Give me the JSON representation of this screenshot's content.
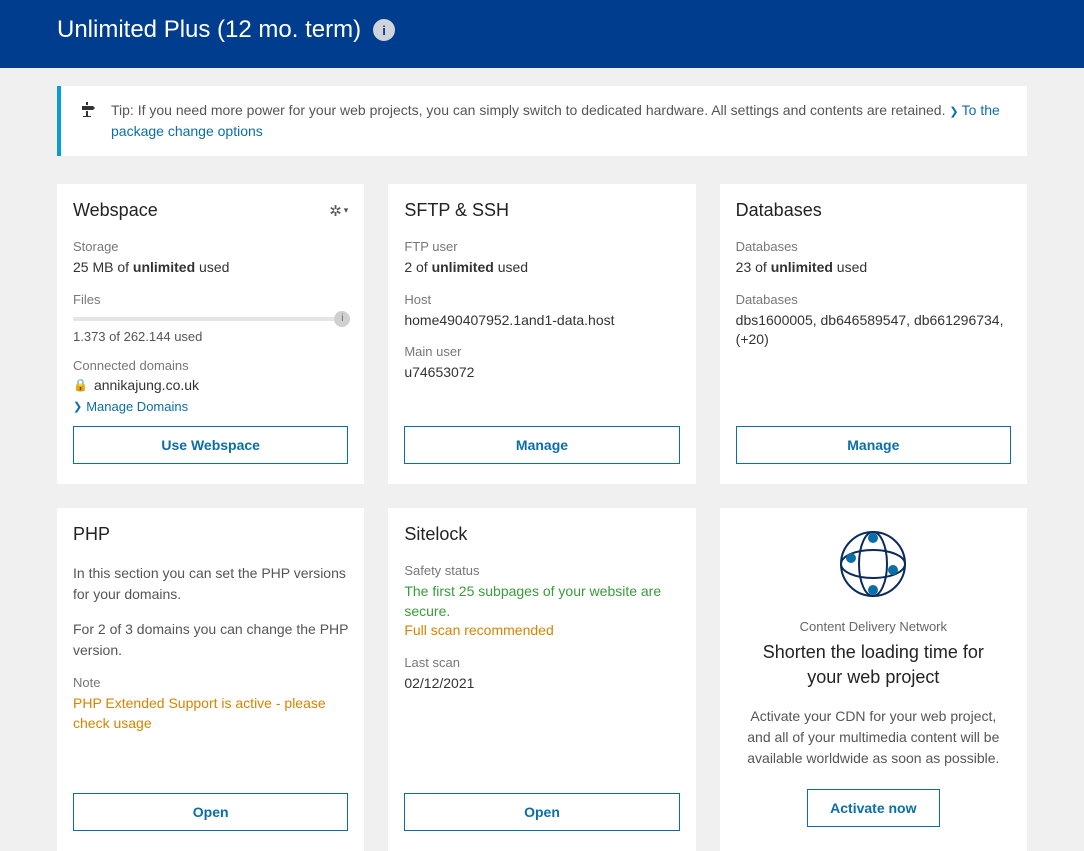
{
  "header": {
    "title": "Unlimited Plus (12 mo. term)"
  },
  "tip": {
    "text": "Tip: If you need more power for your web projects, you can simply switch to dedicated hardware. All settings and contents are retained.",
    "link": "To the package change options"
  },
  "webspace": {
    "title": "Webspace",
    "storage_label": "Storage",
    "storage_prefix": "25 MB of ",
    "storage_bold": "unlimited",
    "storage_suffix": " used",
    "files_label": "Files",
    "files_value": "1.373 of 262.144 used",
    "domains_label": "Connected domains",
    "domain": "annikajung.co.uk",
    "manage_domains": "Manage Domains",
    "button": "Use Webspace"
  },
  "sftp": {
    "title": "SFTP & SSH",
    "ftp_label": "FTP user",
    "ftp_prefix": "2 of ",
    "ftp_bold": "unlimited",
    "ftp_suffix": " used",
    "host_label": "Host",
    "host_value": "home490407952.1and1-data.host",
    "user_label": "Main user",
    "user_value": "u74653072",
    "button": "Manage"
  },
  "databases": {
    "title": "Databases",
    "db_label": "Databases",
    "db_prefix": "23 of ",
    "db_bold": "unlimited",
    "db_suffix": " used",
    "list_label": "Databases",
    "list_value": "dbs1600005, db646589547, db661296734, (+20)",
    "button": "Manage"
  },
  "php": {
    "title": "PHP",
    "desc1": "In this section you can set the PHP versions for your domains.",
    "desc2": "For 2 of 3 domains you can change the PHP version.",
    "note_label": "Note",
    "note_text": "PHP Extended Support is active - please check usage",
    "button": "Open"
  },
  "sitelock": {
    "title": "Sitelock",
    "status_label": "Safety status",
    "status_green": "The first 25 subpages of your website are secure.",
    "status_orange": "Full scan recommended",
    "scan_label": "Last scan",
    "scan_value": "02/12/2021",
    "button": "Open"
  },
  "cdn": {
    "subtitle": "Content Delivery Network",
    "title": "Shorten the loading time for your web project",
    "desc": "Activate your CDN for your web project, and all of your multimedia content will be available worldwide as soon as possible.",
    "button": "Activate now"
  }
}
